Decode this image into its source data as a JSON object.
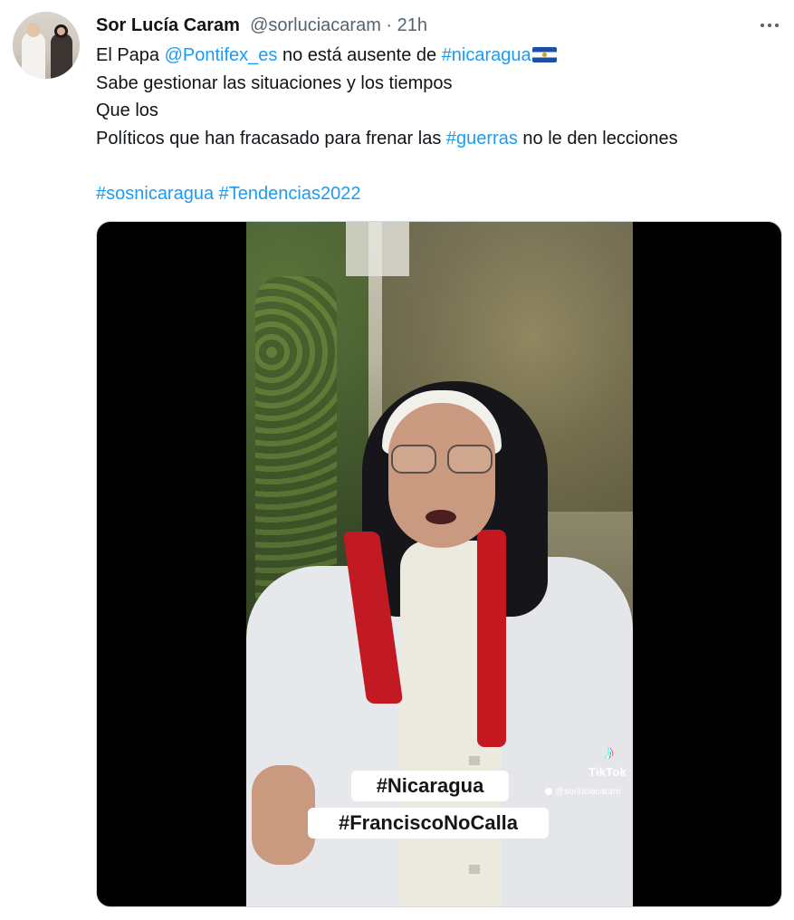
{
  "tweet": {
    "author_name": "Sor Lucía Caram",
    "handle": "@sorluciacaram",
    "separator": " · ",
    "timestamp": "21h",
    "more_icon": "more-horizontal-icon",
    "lines": {
      "l1_pre": "El Papa ",
      "l1_mention": "@Pontifex_es",
      "l1_mid": " no está ausente de ",
      "l1_hashtag": "#nicaragua",
      "l2": "Sabe gestionar las situaciones y los tiempos",
      "l3": "Que los",
      "l4_pre": "Políticos que han fracasado para frenar las ",
      "l4_hashtag": "#guerras",
      "l4_post": " no le den lecciones",
      "l6_hashtag1": "#sosnicaragua",
      "l6_hashtag2": "#Tendencias2022"
    },
    "flag_icon": "nicaragua-flag-icon"
  },
  "video": {
    "caption_line1": "#Nicaragua",
    "caption_line2": "#FranciscoNoCalla",
    "watermark_brand": "TikTok",
    "watermark_user": "@sorluciacaram"
  },
  "colors": {
    "link": "#1d9bf0",
    "muted": "#536471",
    "text": "#0f1419"
  }
}
